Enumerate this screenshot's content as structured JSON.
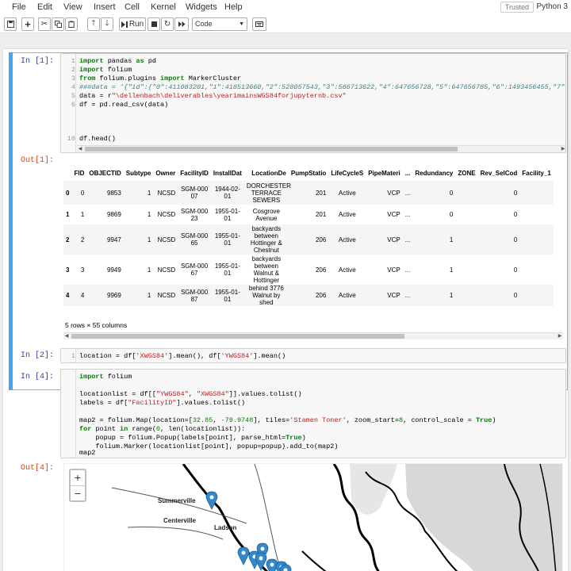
{
  "menu": [
    "File",
    "Edit",
    "View",
    "Insert",
    "Cell",
    "Kernel",
    "Widgets",
    "Help"
  ],
  "trusted": "Trusted",
  "kernel_name": "Python 3",
  "toolbar": {
    "run_label": "Run",
    "cell_type": "Code"
  },
  "cells": {
    "c1": {
      "prompt": "In [1]:"
    },
    "c1_out": {
      "prompt": "Out[1]:"
    },
    "c2": {
      "prompt": "In [2]:"
    },
    "c4": {
      "prompt": "In [4]:"
    },
    "c4_out": {
      "prompt": "Out[4]:"
    }
  },
  "df_table": {
    "columns": [
      "FID",
      "OBJECTID",
      "Subtype",
      "Owner",
      "FacilityID",
      "InstallDat",
      "LocationDe",
      "PumpStatio",
      "LifeCycleS",
      "PipeMateri",
      "...",
      "Redundancy",
      "ZONE",
      "Rev_SelCod",
      "Facility_1"
    ],
    "rows": [
      {
        "idx": "0",
        "cells": [
          "0",
          "9853",
          "1",
          "NCSD",
          "SGM-00007",
          "1944-02-01",
          "DORCHESTER TERRACE SEWERS",
          "201",
          "Active",
          "VCP",
          "...",
          "0",
          "",
          "0",
          ""
        ]
      },
      {
        "idx": "1",
        "cells": [
          "1",
          "9869",
          "1",
          "NCSD",
          "SGM-00023",
          "1955-01-01",
          "Cosgrove Avenue",
          "201",
          "Active",
          "VCP",
          "...",
          "0",
          "",
          "0",
          ""
        ]
      },
      {
        "idx": "2",
        "cells": [
          "2",
          "9947",
          "1",
          "NCSD",
          "SGM-00065",
          "1955-01-01",
          "backyards between Hottinger & Chestnut",
          "206",
          "Active",
          "VCP",
          "...",
          "1",
          "",
          "0",
          ""
        ]
      },
      {
        "idx": "3",
        "cells": [
          "3",
          "9949",
          "1",
          "NCSD",
          "SGM-00067",
          "1955-01-01",
          "backyards between Walnut & Hottinger",
          "206",
          "Active",
          "VCP",
          "...",
          "1",
          "",
          "0",
          ""
        ]
      },
      {
        "idx": "4",
        "cells": [
          "4",
          "9969",
          "1",
          "NCSD",
          "SGM-00087",
          "1955-01-01",
          "behind 3776 Walnut by shed",
          "206",
          "Active",
          "VCP",
          "...",
          "1",
          "",
          "0",
          ""
        ]
      }
    ],
    "shape": "5 rows × 55 columns"
  },
  "map": {
    "zoom_in": "+",
    "zoom_out": "−",
    "places": [
      "Summerville",
      "Centerville",
      "Ladson"
    ]
  },
  "colors": {
    "marker": "#3388cc",
    "selected_bar": "#42A5F5"
  }
}
